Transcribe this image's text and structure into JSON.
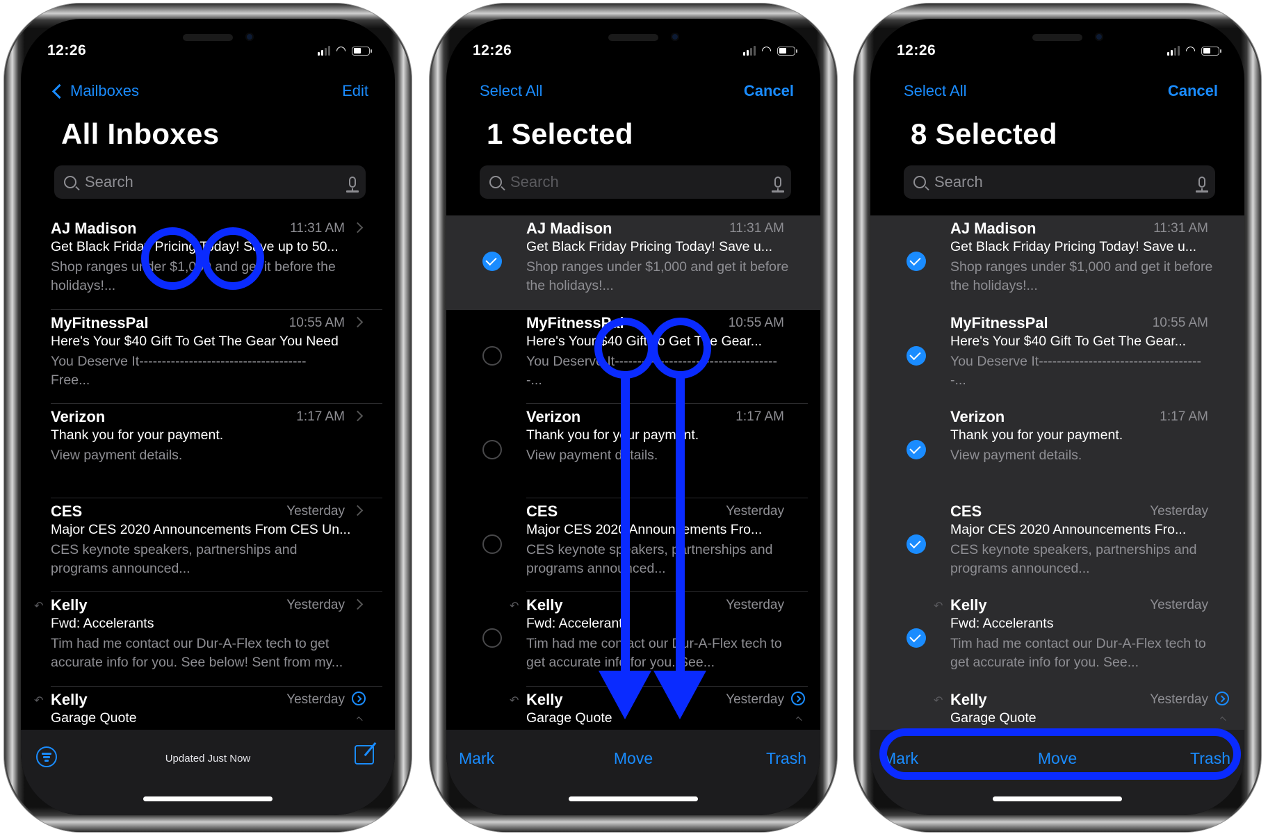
{
  "accent_color": "#1a8cff",
  "annotation_color": "#0a2bff",
  "phones": [
    {
      "status": {
        "time": "12:26"
      },
      "nav": {
        "back_label": "Mailboxes",
        "right_label": "Edit"
      },
      "title": "All Inboxes",
      "search": {
        "placeholder": "Search"
      },
      "emails": [
        {
          "sender": "AJ Madison",
          "time": "11:31 AM",
          "subject": "Get Black Friday Pricing Today! Save up to 50...",
          "preview": "Shop ranges under $1,000 and get it before the holidays!..."
        },
        {
          "sender": "MyFitnessPal",
          "time": "10:55 AM",
          "subject": "Here's Your $40 Gift To Get The Gear You Need",
          "preview": "You Deserve It------------------------------------- Free..."
        },
        {
          "sender": "Verizon",
          "time": "1:17 AM",
          "subject": "Thank you for your payment.",
          "preview": "View payment details."
        },
        {
          "sender": "CES",
          "time": "Yesterday",
          "subject": "Major CES 2020 Announcements From CES Un...",
          "preview": "CES keynote speakers, partnerships and programs announced..."
        },
        {
          "sender": "Kelly",
          "time": "Yesterday",
          "subject": "Fwd: Accelerants",
          "preview": "Tim had me contact our Dur-A-Flex tech to get accurate info for you. See below! Sent from my..."
        },
        {
          "sender": "Kelly",
          "time": "Yesterday",
          "subject": "Garage Quote",
          "preview": ""
        }
      ],
      "toolbar": {
        "status": "Updated Just Now"
      }
    },
    {
      "status": {
        "time": "12:26"
      },
      "nav": {
        "left_label": "Select All",
        "right_label": "Cancel"
      },
      "title": "1 Selected",
      "search": {
        "placeholder": "Search"
      },
      "emails": [
        {
          "sender": "AJ Madison",
          "time": "11:31 AM",
          "subject": "Get Black Friday Pricing Today! Save u...",
          "preview": "Shop ranges under $1,000 and get it before the holidays!...",
          "selected": true
        },
        {
          "sender": "MyFitnessPal",
          "time": "10:55 AM",
          "subject": "Here's Your $40 Gift To Get The Gear...",
          "preview": "You Deserve It-------------------------------------...",
          "selected": false
        },
        {
          "sender": "Verizon",
          "time": "1:17 AM",
          "subject": "Thank you for your payment.",
          "preview": "View payment details.",
          "selected": false
        },
        {
          "sender": "CES",
          "time": "Yesterday",
          "subject": "Major CES 2020 Announcements Fro...",
          "preview": "CES keynote speakers, partnerships and programs announced...",
          "selected": false
        },
        {
          "sender": "Kelly",
          "time": "Yesterday",
          "subject": "Fwd: Accelerants",
          "preview": "Tim had me contact our Dur-A-Flex tech to get accurate info for you. See...",
          "selected": false
        },
        {
          "sender": "Kelly",
          "time": "Yesterday",
          "subject": "Garage Quote",
          "preview": "",
          "selected": false
        }
      ],
      "toolbar": {
        "mark": "Mark",
        "move": "Move",
        "trash": "Trash"
      }
    },
    {
      "status": {
        "time": "12:26"
      },
      "nav": {
        "left_label": "Select All",
        "right_label": "Cancel"
      },
      "title": "8 Selected",
      "search": {
        "placeholder": "Search"
      },
      "emails": [
        {
          "sender": "AJ Madison",
          "time": "11:31 AM",
          "subject": "Get Black Friday Pricing Today! Save u...",
          "preview": "Shop ranges under $1,000 and get it before the holidays!...",
          "selected": true
        },
        {
          "sender": "MyFitnessPal",
          "time": "10:55 AM",
          "subject": "Here's Your $40 Gift To Get The Gear...",
          "preview": "You Deserve It-------------------------------------...",
          "selected": true
        },
        {
          "sender": "Verizon",
          "time": "1:17 AM",
          "subject": "Thank you for your payment.",
          "preview": "View payment details.",
          "selected": true
        },
        {
          "sender": "CES",
          "time": "Yesterday",
          "subject": "Major CES 2020 Announcements Fro...",
          "preview": "CES keynote speakers, partnerships and programs announced...",
          "selected": true
        },
        {
          "sender": "Kelly",
          "time": "Yesterday",
          "subject": "Fwd: Accelerants",
          "preview": "Tim had me contact our Dur-A-Flex tech to get accurate info for you. See...",
          "selected": true
        },
        {
          "sender": "Kelly",
          "time": "Yesterday",
          "subject": "Garage Quote",
          "preview": "",
          "selected": true
        }
      ],
      "toolbar": {
        "mark": "Mark",
        "move": "Move",
        "trash": "Trash"
      }
    }
  ]
}
